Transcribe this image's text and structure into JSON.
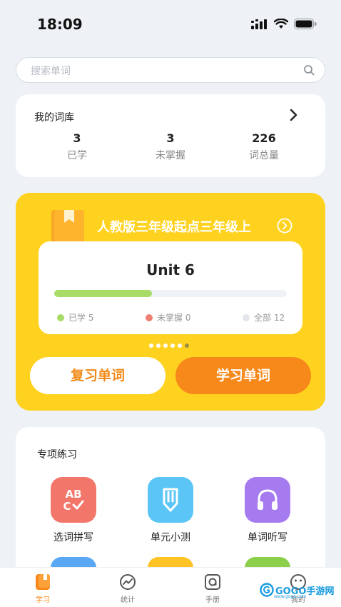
{
  "status_bar": {
    "time": "18:09"
  },
  "search": {
    "placeholder": "搜索单词"
  },
  "library": {
    "title": "我的词库",
    "stats": [
      {
        "value": "3",
        "label": "已学"
      },
      {
        "value": "3",
        "label": "未掌握"
      },
      {
        "value": "226",
        "label": "词总量"
      }
    ]
  },
  "book": {
    "title": "人教版三年级起点三年级上",
    "unit": "Unit 6",
    "progress": 0.42,
    "legend": [
      {
        "label": "已学 5",
        "color": "#a8dc66"
      },
      {
        "label": "未掌握 0",
        "color": "#f07f73"
      },
      {
        "label": "全部 12",
        "color": "#e3e6ea"
      }
    ],
    "pages": 6,
    "active_page": 5,
    "review_button": "复习单词",
    "learn_button": "学习单词"
  },
  "practice": {
    "title": "专项练习",
    "features": [
      {
        "label": "选词拼写",
        "icon": "abc-check-icon",
        "color": "#f2776a"
      },
      {
        "label": "单元小测",
        "icon": "pencil-icon",
        "color": "#5bc6f5"
      },
      {
        "label": "单词听写",
        "icon": "headphones-icon",
        "color": "#a77bf0"
      }
    ],
    "peek_colors": [
      "#5aa8f3",
      "#ffc326",
      "#8bcf4a"
    ]
  },
  "tabs": [
    {
      "label": "学习",
      "icon": "book-icon"
    },
    {
      "label": "统计",
      "icon": "chart-icon"
    },
    {
      "label": "手册",
      "icon": "handbook-icon"
    },
    {
      "label": "我的",
      "icon": "profile-icon"
    }
  ],
  "watermark": {
    "text": "GOGO手游网",
    "sub": "www.gogo.com"
  },
  "colors": {
    "accent": "#f28a18",
    "brand_yellow": "#ffd21f"
  }
}
